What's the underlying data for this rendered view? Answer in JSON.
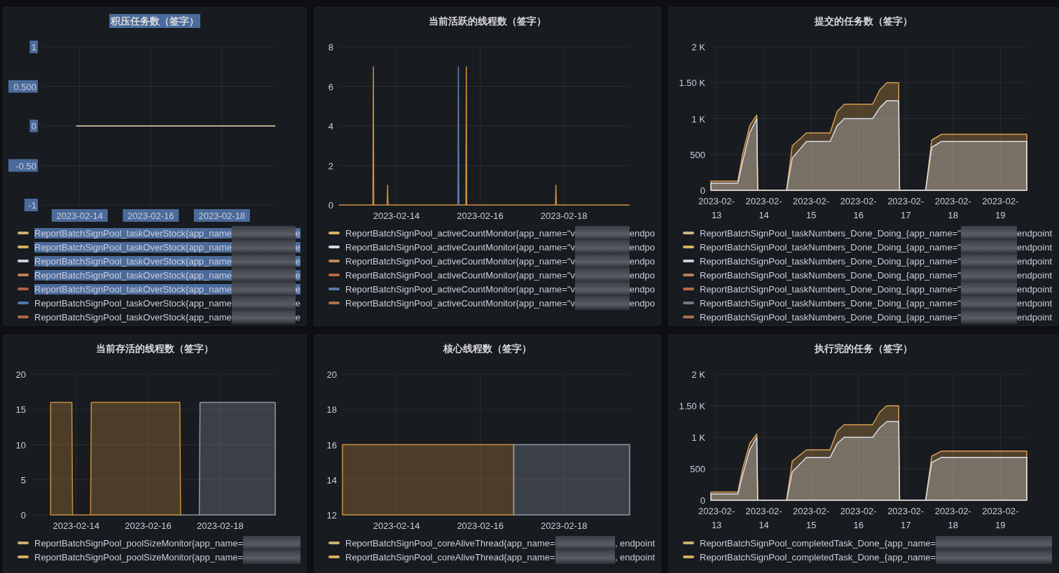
{
  "panels": [
    {
      "title": "积压任务数（签字）",
      "selected": true,
      "chart_data": {
        "grid": true,
        "type": "line",
        "xlim": [
          "2023-02-12T22:34",
          "2023-02-19T12:00"
        ],
        "ylim": [
          -1,
          1
        ],
        "yticks": [
          {
            "value": -1,
            "label": "-1"
          },
          {
            "value": -0.5,
            "label": "-0.50"
          },
          {
            "value": 0,
            "label": "0"
          },
          {
            "value": 0.5,
            "label": "0.500"
          },
          {
            "value": 1,
            "label": "1"
          }
        ],
        "xticks": [
          "2023-02-14",
          "2023-02-16",
          "2023-02-18"
        ],
        "x": [
          "2023-02-13T21:36",
          "2023-02-19T12:00"
        ],
        "series": [
          {
            "color": "#e8d8a8",
            "values": [
              0,
              0
            ]
          }
        ]
      },
      "legend": [
        {
          "label": "ReportBatchSignPool_taskOverStock{app_name",
          "suffix": "e",
          "color": "#c8b070",
          "selected": true
        },
        {
          "label": "ReportBatchSignPool_taskOverStock{app_name",
          "suffix": "e",
          "color": "#d4b060",
          "selected": true
        },
        {
          "label": "ReportBatchSignPool_taskOverStock{app_name",
          "suffix": "e",
          "color": "#c8d0e0",
          "selected": true
        },
        {
          "label": "ReportBatchSignPool_taskOverStock{app_name",
          "suffix": "e",
          "color": "#c08050",
          "selected": true
        },
        {
          "label": "ReportBatchSignPool_taskOverStock{app_name",
          "suffix": "e",
          "color": "#b06040",
          "selected": true
        },
        {
          "label": "ReportBatchSignPool_taskOverStock{app_name",
          "suffix": "e",
          "color": "#5078b0",
          "selected": false
        },
        {
          "label": "ReportBatchSignPool_taskOverStock{app_name",
          "suffix": "e",
          "color": "#b06848",
          "selected": false
        }
      ]
    },
    {
      "title": "当前活跃的线程数（签字）",
      "selected": false,
      "chart_data": {
        "grid": true,
        "type": "line",
        "xlim": [
          "2023-02-12T15:07",
          "2023-02-19T13:41"
        ],
        "ylim": [
          0,
          8
        ],
        "yticks": [
          0,
          2,
          4,
          6,
          8
        ],
        "xticks": [
          "2023-02-14",
          "2023-02-16",
          "2023-02-18"
        ],
        "x": [
          "2023-02-12T15:07",
          "2023-02-13T10:34",
          "2023-02-13T10:48",
          "2023-02-13T11:02",
          "2023-02-13T18:43",
          "2023-02-13T18:58",
          "2023-02-13T19:12",
          "2023-02-15T11:17",
          "2023-02-15T11:31",
          "2023-02-15T11:46",
          "2023-02-15T15:50",
          "2023-02-15T16:05",
          "2023-02-15T16:19",
          "2023-02-17T19:12",
          "2023-02-17T19:26",
          "2023-02-17T19:41",
          "2023-02-19T13:41"
        ],
        "series": [
          {
            "color": "#d09040",
            "values": [
              0,
              0,
              7,
              0,
              0,
              1,
              0,
              0,
              0,
              0,
              0,
              7,
              0,
              0,
              1,
              0,
              0
            ]
          },
          {
            "color": "#6080b8",
            "values": [
              null,
              null,
              null,
              null,
              null,
              null,
              null,
              0,
              7,
              0,
              null,
              null,
              null,
              null,
              null,
              null,
              null
            ]
          }
        ]
      },
      "legend": [
        {
          "label": "ReportBatchSignPool_activeCountMonitor{app_name=\"v",
          "suffix": "endpo",
          "color": "#d4b060",
          "selected": false
        },
        {
          "label": "ReportBatchSignPool_activeCountMonitor{app_name=\"v",
          "suffix": "endpo",
          "color": "#d0d8e8",
          "selected": false
        },
        {
          "label": "ReportBatchSignPool_activeCountMonitor{app_name=\"v",
          "suffix": "endpo",
          "color": "#c08858",
          "selected": false
        },
        {
          "label": "ReportBatchSignPool_activeCountMonitor{app_name=\"v",
          "suffix": "endpo",
          "color": "#b86a48",
          "selected": false
        },
        {
          "label": "ReportBatchSignPool_activeCountMonitor{app_name=\"v",
          "suffix": "endpo",
          "color": "#5a78a8",
          "selected": false
        },
        {
          "label": "ReportBatchSignPool_activeCountMonitor{app_name=\"v",
          "suffix": "endpo",
          "color": "#b07050",
          "selected": false
        }
      ]
    },
    {
      "title": "提交的任务数（签字）",
      "selected": false,
      "chart_data": {
        "grid": true,
        "type": "area",
        "xlim": [
          "2023-02-12T21:07",
          "2023-02-19T13:26"
        ],
        "ylim": [
          0,
          2000
        ],
        "yticks": [
          {
            "value": 0,
            "label": "0"
          },
          {
            "value": 500,
            "label": "500"
          },
          {
            "value": 1000,
            "label": "1 K"
          },
          {
            "value": 1500,
            "label": "1.50 K"
          },
          {
            "value": 2000,
            "label": "2 K"
          }
        ],
        "xticks": [
          "2023-02-13",
          "2023-02-14",
          "2023-02-15",
          "2023-02-16",
          "2023-02-17",
          "2023-02-18",
          "2023-02-19"
        ],
        "x": [
          "2023-02-12T21:07",
          "2023-02-13T10:48",
          "2023-02-13T13:12",
          "2023-02-13T16:48",
          "2023-02-13T20:24",
          "2023-02-13T20:53",
          "2023-02-14T11:31",
          "2023-02-14T14:24",
          "2023-02-14T21:36",
          "2023-02-15T09:36",
          "2023-02-15T13:12",
          "2023-02-15T16:48",
          "2023-02-16T07:12",
          "2023-02-16T10:48",
          "2023-02-16T14:24",
          "2023-02-16T20:24",
          "2023-02-16T20:53",
          "2023-02-17T10:05",
          "2023-02-17T13:12",
          "2023-02-17T18:00",
          "2023-02-19T13:26"
        ],
        "series": [
          {
            "color": "#d8a050",
            "values": [
              130,
              130,
              500,
              900,
              1050,
              0,
              0,
              620,
              800,
              800,
              1100,
              1200,
              1200,
              1400,
              1500,
              1500,
              0,
              0,
              700,
              780,
              780
            ]
          },
          {
            "color": "#d8dce8",
            "values": [
              100,
              100,
              400,
              800,
              1000,
              0,
              0,
              450,
              680,
              680,
              900,
              1000,
              1000,
              1150,
              1250,
              1250,
              0,
              0,
              600,
              680,
              680
            ]
          }
        ]
      },
      "legend": [
        {
          "label": "ReportBatchSignPool_taskNumbers_Done_Doing_{app_name=\"",
          "suffix": "endpoint",
          "color": "#c8b88a",
          "selected": false
        },
        {
          "label": "ReportBatchSignPool_taskNumbers_Done_Doing_{app_name=\"",
          "suffix": "endpoint",
          "color": "#d4b060",
          "selected": false
        },
        {
          "label": "ReportBatchSignPool_taskNumbers_Done_Doing_{app_name=\"",
          "suffix": "endpoint",
          "color": "#c8d0e0",
          "selected": false
        },
        {
          "label": "ReportBatchSignPool_taskNumbers_Done_Doing_{app_name=\"",
          "suffix": "endpoint",
          "color": "#b88060",
          "selected": false
        },
        {
          "label": "ReportBatchSignPool_taskNumbers_Done_Doing_{app_name=\"",
          "suffix": "endpoint",
          "color": "#b86a48",
          "selected": false
        },
        {
          "label": "ReportBatchSignPool_taskNumbers_Done_Doing_{app_name=\"",
          "suffix": "endpoint",
          "color": "#707888",
          "selected": false
        },
        {
          "label": "ReportBatchSignPool_taskNumbers_Done_Doing_{app_name=\"",
          "suffix": "endpoint",
          "color": "#a87058",
          "selected": false
        }
      ]
    },
    {
      "title": "当前存活的线程数（签字）",
      "selected": false,
      "chart_data": {
        "grid": true,
        "type": "area",
        "xlim": [
          "2023-02-12T18:14",
          "2023-02-19T12:43"
        ],
        "ylim": [
          0,
          20
        ],
        "yticks": [
          0,
          5,
          10,
          15,
          20
        ],
        "xticks": [
          "2023-02-14",
          "2023-02-16",
          "2023-02-18"
        ],
        "x": [
          "2023-02-13T06:58",
          "2023-02-13T21:07",
          "2023-02-13T21:36",
          "2023-02-14T09:36",
          "2023-02-14T10:05",
          "2023-02-16T21:07",
          "2023-02-16T21:36",
          "2023-02-17T10:05",
          "2023-02-17T10:34",
          "2023-02-19T12:43"
        ],
        "series": [
          {
            "color": "#c89040",
            "values": [
              16,
              16,
              0,
              0,
              16,
              16,
              0,
              null,
              null,
              null
            ]
          },
          {
            "color": "#9098a8",
            "values": [
              null,
              null,
              null,
              null,
              null,
              null,
              0,
              0,
              16,
              16
            ]
          }
        ]
      },
      "legend": [
        {
          "label": "ReportBatchSignPool_poolSizeMonitor{app_name=",
          "color": "#c8b070",
          "selected": false
        },
        {
          "label": "ReportBatchSignPool_poolSizeMonitor{app_name=",
          "color": "#d4b060",
          "selected": false
        }
      ]
    },
    {
      "title": "核心线程数（签字）",
      "selected": false,
      "chart_data": {
        "grid": true,
        "type": "area",
        "xlim": [
          "2023-02-12T17:02",
          "2023-02-19T13:41"
        ],
        "ylim": [
          12,
          20
        ],
        "yticks": [
          12,
          14,
          16,
          18,
          20
        ],
        "xticks": [
          "2023-02-14",
          "2023-02-16",
          "2023-02-18"
        ],
        "x": [
          "2023-02-12T17:02",
          "2023-02-13T16:48",
          "2023-02-16T19:12",
          "2023-02-19T13:41"
        ],
        "series": [
          {
            "color": "#c89040",
            "values": [
              16,
              16,
              16,
              null
            ]
          },
          {
            "color": "#9098a8",
            "values": [
              null,
              null,
              16,
              16
            ]
          }
        ]
      },
      "legend": [
        {
          "label": "ReportBatchSignPool_coreAliveThread{app_name=",
          "suffix": ", endpoint",
          "color": "#c8b070",
          "selected": false
        },
        {
          "label": "ReportBatchSignPool_coreAliveThread{app_name=",
          "suffix": ", endpoint",
          "color": "#d4b060",
          "selected": false
        }
      ]
    },
    {
      "title": "执行完的任务（签字）",
      "selected": false,
      "chart_data": {
        "grid": true,
        "type": "area",
        "xlim": [
          "2023-02-12T21:07",
          "2023-02-19T13:26"
        ],
        "ylim": [
          0,
          2000
        ],
        "yticks": [
          {
            "value": 0,
            "label": "0"
          },
          {
            "value": 500,
            "label": "500"
          },
          {
            "value": 1000,
            "label": "1 K"
          },
          {
            "value": 1500,
            "label": "1.50 K"
          },
          {
            "value": 2000,
            "label": "2 K"
          }
        ],
        "xticks": [
          "2023-02-13",
          "2023-02-14",
          "2023-02-15",
          "2023-02-16",
          "2023-02-17",
          "2023-02-18",
          "2023-02-19"
        ],
        "x": [
          "2023-02-12T21:07",
          "2023-02-13T10:48",
          "2023-02-13T13:12",
          "2023-02-13T16:48",
          "2023-02-13T20:24",
          "2023-02-13T20:53",
          "2023-02-14T11:31",
          "2023-02-14T14:24",
          "2023-02-14T21:36",
          "2023-02-15T09:36",
          "2023-02-15T13:12",
          "2023-02-15T16:48",
          "2023-02-16T07:12",
          "2023-02-16T10:48",
          "2023-02-16T14:24",
          "2023-02-16T20:24",
          "2023-02-16T20:53",
          "2023-02-17T10:05",
          "2023-02-17T13:12",
          "2023-02-17T18:00",
          "2023-02-19T13:26"
        ],
        "series": [
          {
            "color": "#d8a050",
            "values": [
              130,
              130,
              500,
              900,
              1050,
              0,
              0,
              620,
              800,
              800,
              1100,
              1200,
              1200,
              1400,
              1500,
              1500,
              0,
              0,
              700,
              780,
              780
            ]
          },
          {
            "color": "#d8dce8",
            "values": [
              100,
              100,
              400,
              800,
              1000,
              0,
              0,
              450,
              680,
              680,
              900,
              1000,
              1000,
              1150,
              1250,
              1250,
              0,
              0,
              600,
              680,
              680
            ]
          }
        ]
      },
      "legend": [
        {
          "label": "ReportBatchSignPool_completedTask_Done_{app_name=",
          "color": "#c8b070",
          "selected": false
        },
        {
          "label": "ReportBatchSignPool_completedTask_Done_{app_name=",
          "color": "#d4b060",
          "selected": false
        }
      ]
    }
  ]
}
